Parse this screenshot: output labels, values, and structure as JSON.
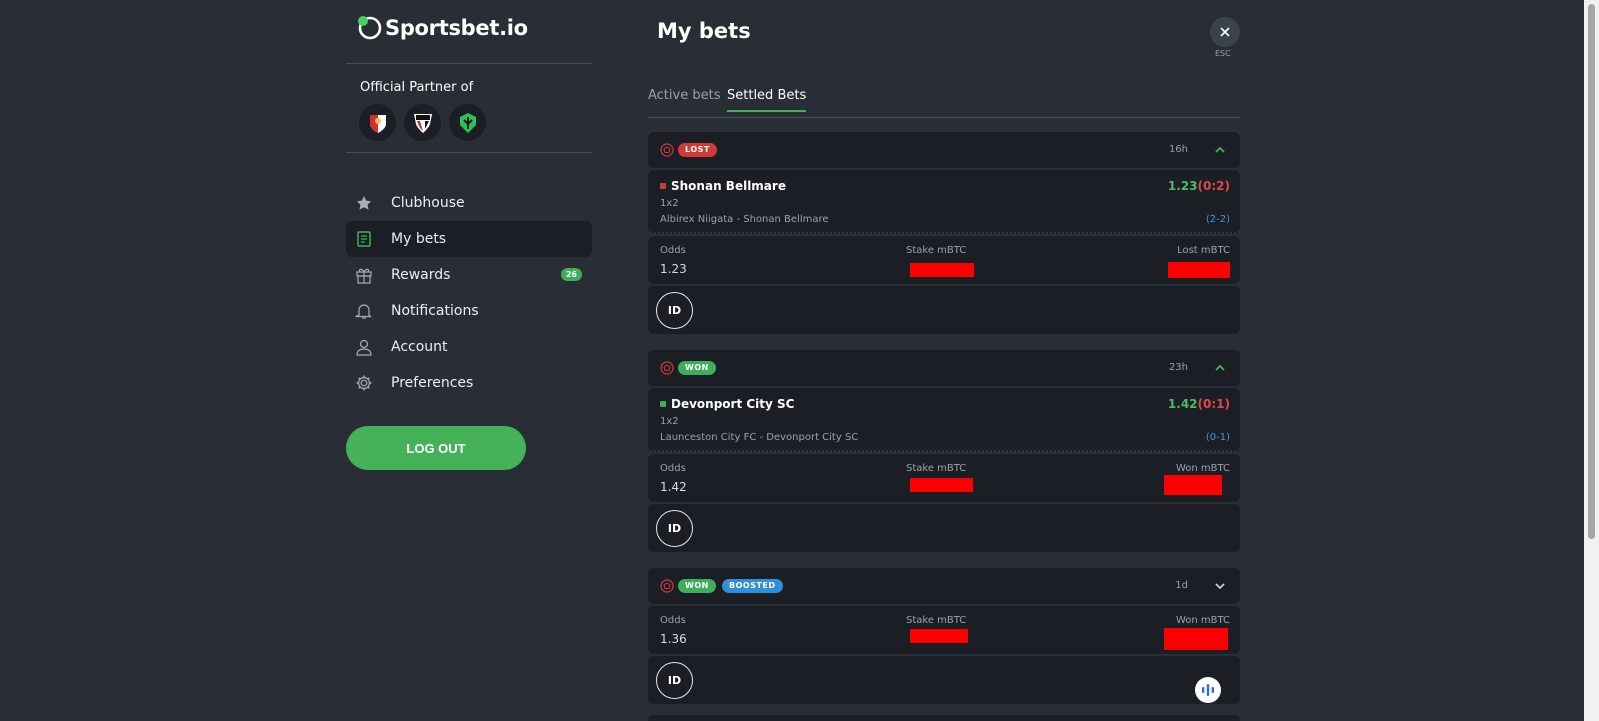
{
  "brand": {
    "name": "Sportsbet.io",
    "accent": "#45b25a"
  },
  "sidebar": {
    "partner_title": "Official Partner of",
    "partners": [
      "southampton-crest",
      "sao-paulo-crest",
      "esports-crest"
    ],
    "items": [
      {
        "label": "Clubhouse",
        "icon": "star-icon"
      },
      {
        "label": "My bets",
        "icon": "betslip-icon",
        "active": true
      },
      {
        "label": "Rewards",
        "icon": "gift-icon",
        "badge": "26"
      },
      {
        "label": "Notifications",
        "icon": "bell-icon"
      },
      {
        "label": "Account",
        "icon": "user-icon"
      },
      {
        "label": "Preferences",
        "icon": "gear-icon"
      }
    ],
    "logout_label": "LOG OUT"
  },
  "main": {
    "title": "My bets",
    "esc_label": "ESC",
    "tabs": [
      {
        "label": "Active bets",
        "active": false
      },
      {
        "label": "Settled Bets",
        "active": true
      }
    ],
    "bets": [
      {
        "status": "LOST",
        "time": "16h",
        "selection": "Shonan Bellmare",
        "odds_display": "1.23",
        "score": "(0:2)",
        "market": "1x2",
        "match": "Albirex Niigata - Shonan Bellmare",
        "ft_score": "(2-2)",
        "odds_label": "Odds",
        "odds": "1.23",
        "stake_label": "Stake mBTC",
        "result_label": "Lost mBTC",
        "id_label": "ID"
      },
      {
        "status": "WON",
        "time": "23h",
        "selection": "Devonport City SC",
        "odds_display": "1.42",
        "score": "(0:1)",
        "market": "1x2",
        "match": "Launceston City FC - Devonport City SC",
        "ft_score": "(0-1)",
        "odds_label": "Odds",
        "odds": "1.42",
        "stake_label": "Stake mBTC",
        "result_label": "Won mBTC",
        "id_label": "ID"
      },
      {
        "status": "WON",
        "extra_badge": "BOOSTED",
        "time": "1d",
        "odds_label": "Odds",
        "odds": "1.36",
        "stake_label": "Stake mBTC",
        "result_label": "Won mBTC",
        "id_label": "ID"
      }
    ]
  }
}
